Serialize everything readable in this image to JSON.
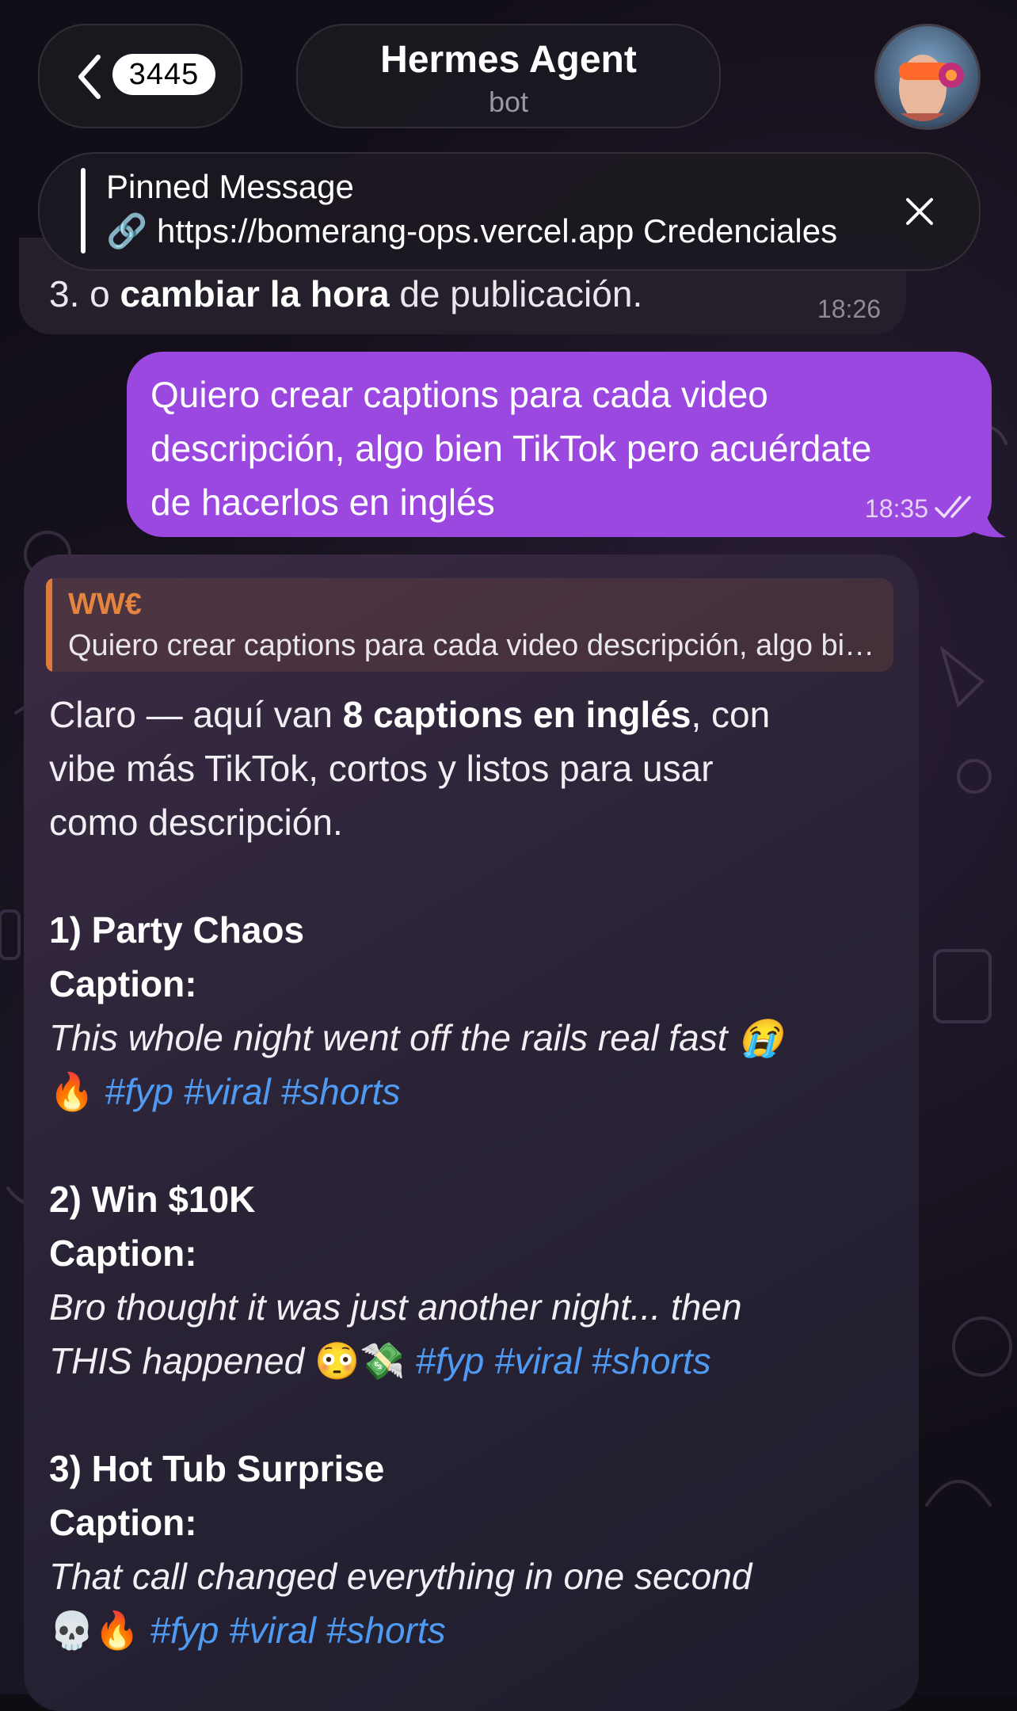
{
  "header": {
    "unread_count": "3445",
    "title": "Hermes Agent",
    "subtitle": "bot"
  },
  "pinned": {
    "label": "Pinned Message",
    "text": "🔗 https://bomerang-ops.vercel.app Credenciales"
  },
  "previous_message": {
    "prefix": "3. o ",
    "bold": "cambiar la hora",
    "suffix": " de publicación.",
    "time": "18:26"
  },
  "outgoing_message": {
    "lines": [
      "Quiero crear captions para cada video",
      "descripción, algo bien TikTok pero acuérdate",
      "de hacerlos en inglés"
    ],
    "time": "18:35",
    "status": "read"
  },
  "incoming_message": {
    "reply_to": {
      "name": "WW€",
      "text": "Quiero crear captions para cada video descripción, algo bien TikTok pero acuérdate de hacerlos en inglés"
    },
    "intro": {
      "pre": "Claro — aquí van ",
      "bold": "8 captions en inglés",
      "post": ", con",
      "line2": "vibe más TikTok, cortos y listos para usar",
      "line3": "como descripción."
    },
    "caption_label": "Caption:",
    "items": [
      {
        "heading": "1) Party Chaos",
        "line1": "This whole night went off the rails real fast 😭",
        "line2_emoji": "🔥",
        "line2_text": "",
        "hashtags": "#fyp #viral #shorts"
      },
      {
        "heading": "2) Win $10K",
        "line1": "Bro thought it was just another night... then",
        "line2_text": "THIS happened",
        "line2_emoji": "😳💸",
        "hashtags": "#fyp #viral #shorts"
      },
      {
        "heading": "3) Hot Tub Surprise",
        "line1": "That call changed everything in one second",
        "line2_emoji": "💀🔥",
        "line2_text": "",
        "hashtags": "#fyp #viral #shorts"
      }
    ]
  },
  "colors": {
    "outgoing_bubble": "#9b48e0",
    "hashtag": "#4f9bf3",
    "reply_accent": "#e07a3a"
  }
}
